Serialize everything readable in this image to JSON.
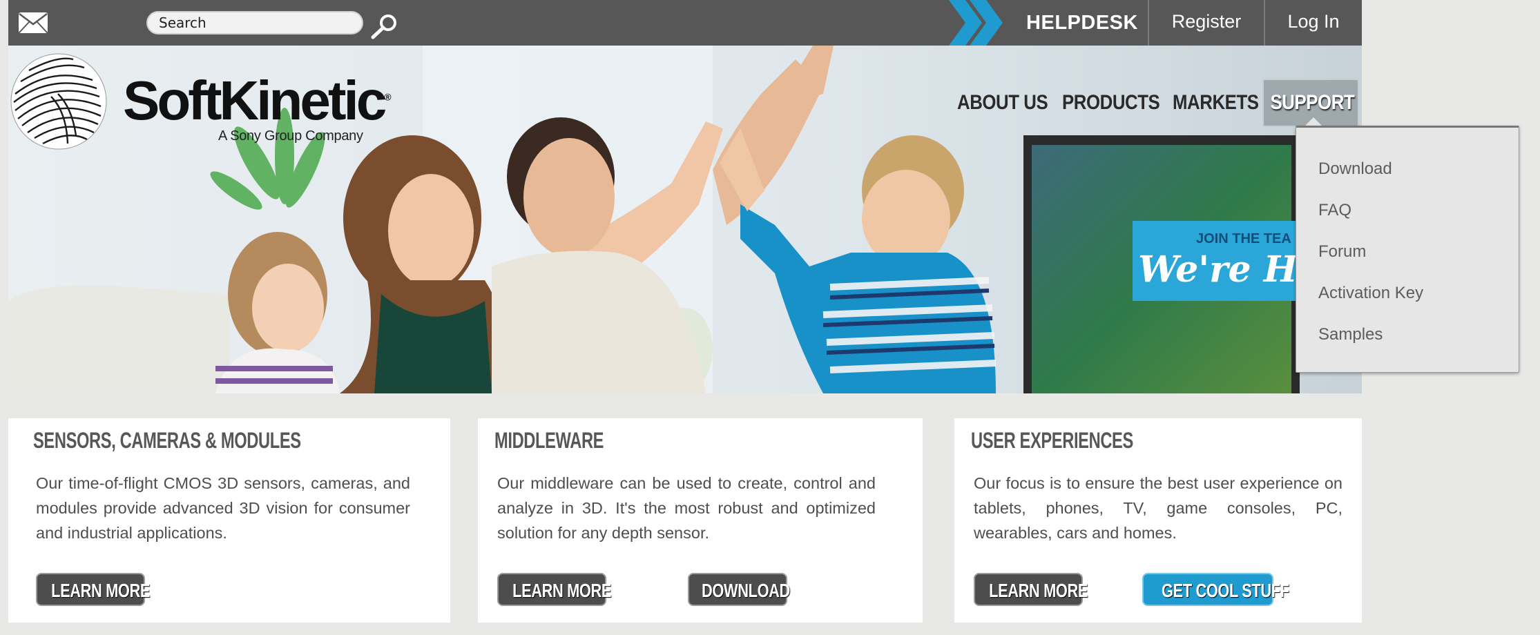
{
  "topbar": {
    "search_placeholder": "Search",
    "helpdesk": "HELPDESK",
    "register": "Register",
    "login": "Log In"
  },
  "brand": {
    "name": "SoftKinetic",
    "tagline": "A Sony Group Company"
  },
  "nav": {
    "items": [
      "ABOUT US",
      "PRODUCTS",
      "MARKETS"
    ],
    "active": "SUPPORT"
  },
  "dropdown": {
    "items": [
      "Download",
      "FAQ",
      "Forum",
      "Activation Key",
      "Samples"
    ]
  },
  "hero": {
    "banner_small": "JOIN THE TEA",
    "banner_big": "We're Hi"
  },
  "cards": [
    {
      "title": "SENSORS, CAMERAS & MODULES",
      "text": "Our time-of-flight CMOS 3D sensors, cameras, and modules provide advanced 3D vision for consumer and industrial applications.",
      "buttons": [
        "LEARN MORE"
      ]
    },
    {
      "title": "MIDDLEWARE",
      "text": "Our middleware can be used to create, control and analyze in 3D. It's the most robust and optimized solution for any depth sensor.",
      "buttons": [
        "LEARN MORE",
        "DOWNLOAD"
      ]
    },
    {
      "title": "USER EXPERIENCES",
      "text": "Our focus is to ensure the best user experience on tablets, phones, TV, game consoles, PC, wearables, cars and homes.",
      "buttons": [
        "LEARN MORE",
        "GET COOL STUFF"
      ]
    }
  ],
  "colors": {
    "topbar": "#575757",
    "accent_blue": "#1f9bd0",
    "button_dark": "#4d4d4d",
    "support_tab": "#9ea8ad"
  }
}
